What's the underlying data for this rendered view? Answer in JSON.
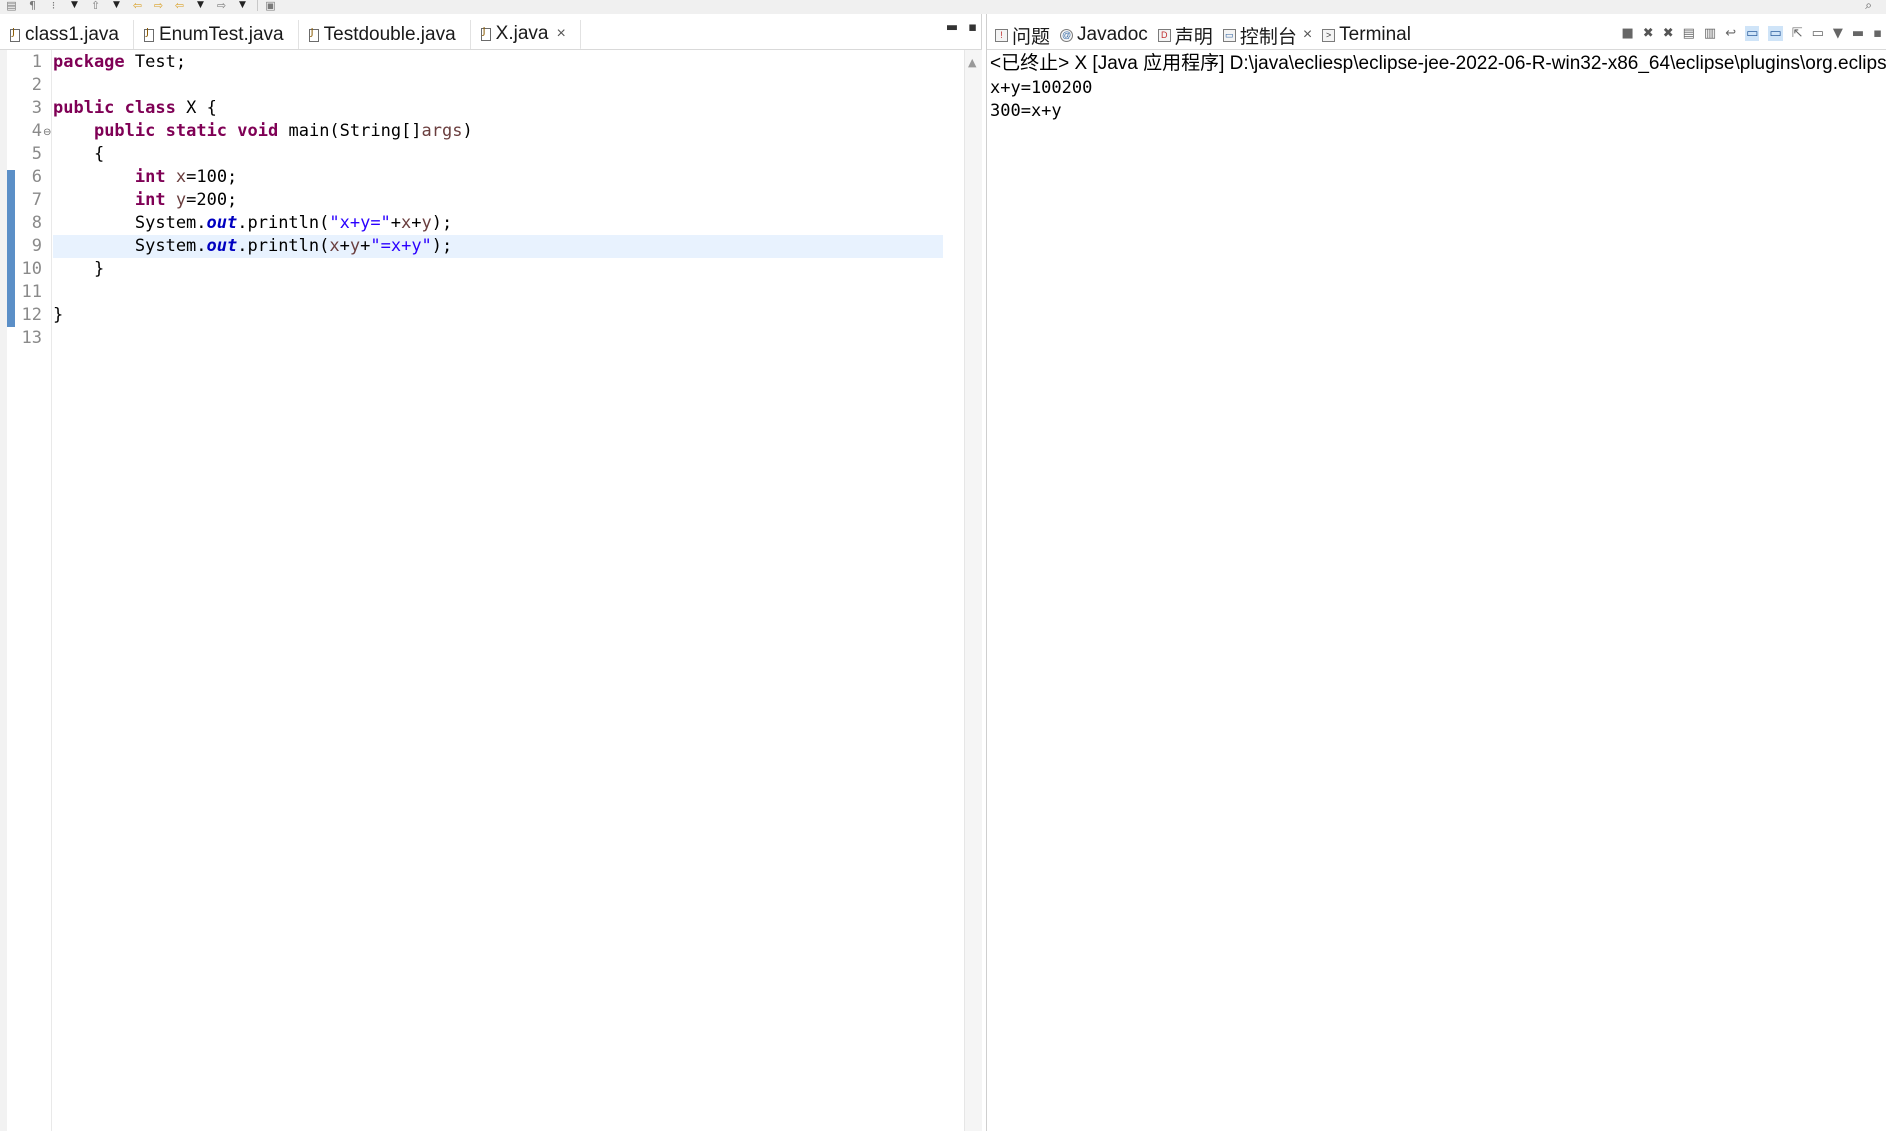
{
  "toolbar": {
    "icons": [
      "file-icon",
      "paragraph-icon",
      "pin-icon",
      "dropdown-icon",
      "up-icon",
      "dropdown-icon",
      "back-arrow-icon",
      "forward-arrow-icon",
      "prev-edit-icon",
      "dropdown-icon",
      "forward-icon",
      "dropdown-icon",
      "open-perspective-icon"
    ],
    "search_icon": "search-icon"
  },
  "editor": {
    "tabs": [
      {
        "label": "class1.java",
        "active": false
      },
      {
        "label": "EnumTest.java",
        "active": false
      },
      {
        "label": "Testdouble.java",
        "active": false
      },
      {
        "label": "X.java",
        "active": true
      }
    ],
    "line_numbers": [
      "1",
      "2",
      "3",
      "4",
      "5",
      "6",
      "7",
      "8",
      "9",
      "10",
      "11",
      "12",
      "13"
    ],
    "current_line": 9,
    "code_lines": [
      "package Test;",
      "",
      "public class X {",
      "    public static void main(String[]args)",
      "    {",
      "        int x=100;",
      "        int y=200;",
      "        System.out.println(\"x+y=\"+x+y);",
      "        System.out.println(x+y+\"=x+y\");",
      "    }",
      "",
      "}",
      ""
    ]
  },
  "console": {
    "tabs": [
      {
        "label": "问题",
        "icon": "problems-icon",
        "closable": false
      },
      {
        "label": "Javadoc",
        "icon": "javadoc-icon",
        "closable": false
      },
      {
        "label": "声明",
        "icon": "declaration-icon",
        "closable": false
      },
      {
        "label": "控制台",
        "icon": "console-icon",
        "closable": true,
        "active": true
      },
      {
        "label": "Terminal",
        "icon": "terminal-icon",
        "closable": false
      }
    ],
    "header": "<已终止> X [Java 应用程序] D:\\java\\ecliesp\\eclipse-jee-2022-06-R-win32-x86_64\\eclipse\\plugins\\org.eclipse",
    "output": [
      "x+y=100200",
      "300=x+y"
    ]
  },
  "colors": {
    "keyword": "#7f0055",
    "string": "#2a00ff",
    "field": "#0000c0",
    "current_line": "#e8f2fe",
    "change_bar": "#5b8fc7"
  }
}
